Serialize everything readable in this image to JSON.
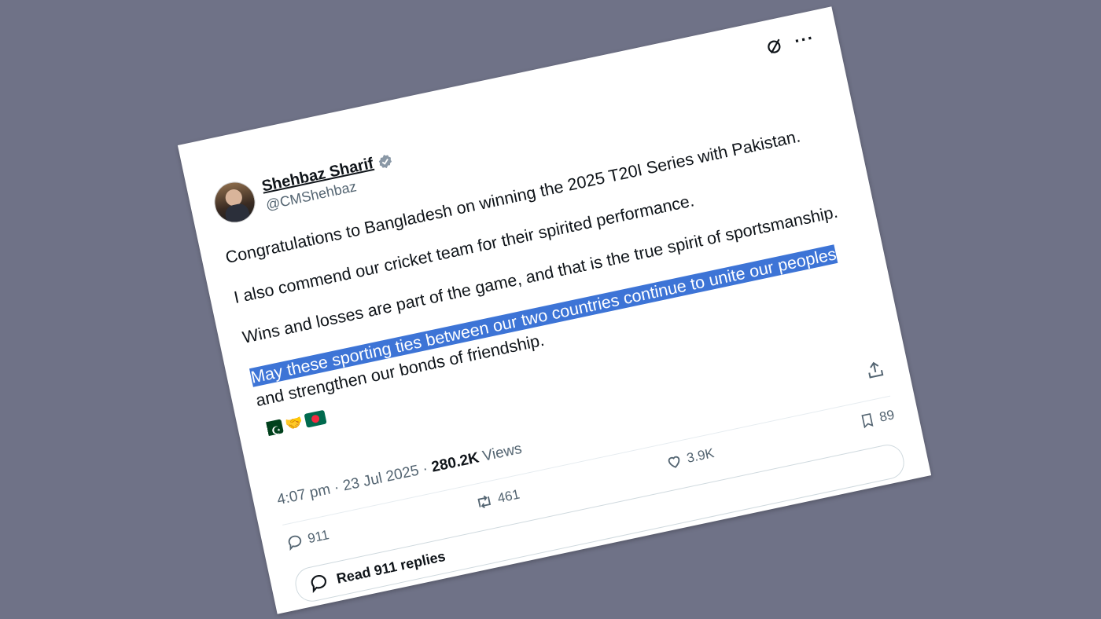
{
  "author": {
    "display_name": "Shehbaz Sharif",
    "handle": "@CMShehbaz"
  },
  "tweet": {
    "paragraph_1": "Congratulations to Bangladesh on winning the 2025 T20I Series with Pakistan.",
    "paragraph_2": "I also commend our cricket team for their spirited performance.",
    "paragraph_3": "Wins and losses are part of the game, and that is the true spirit of sportsmanship.",
    "paragraph_4_highlighted": "May these sporting ties between our two countries continue to unite our peoples",
    "paragraph_4_rest": " and strengthen our bonds of friendship.",
    "emojis": [
      "pakistan-flag",
      "handshake",
      "bangladesh-flag"
    ]
  },
  "meta": {
    "time": "4:07 pm",
    "date": "23 Jul 2025",
    "views_count": "280.2K",
    "views_label": "Views"
  },
  "stats": {
    "replies": "911",
    "reposts": "461",
    "likes": "3.9K",
    "bookmarks": "89"
  },
  "read_replies_label": "Read 911 replies",
  "colors": {
    "background": "#6f7287",
    "highlight": "#3d74d6",
    "verified_badge": "#8a98a6",
    "secondary_text": "#536471"
  }
}
